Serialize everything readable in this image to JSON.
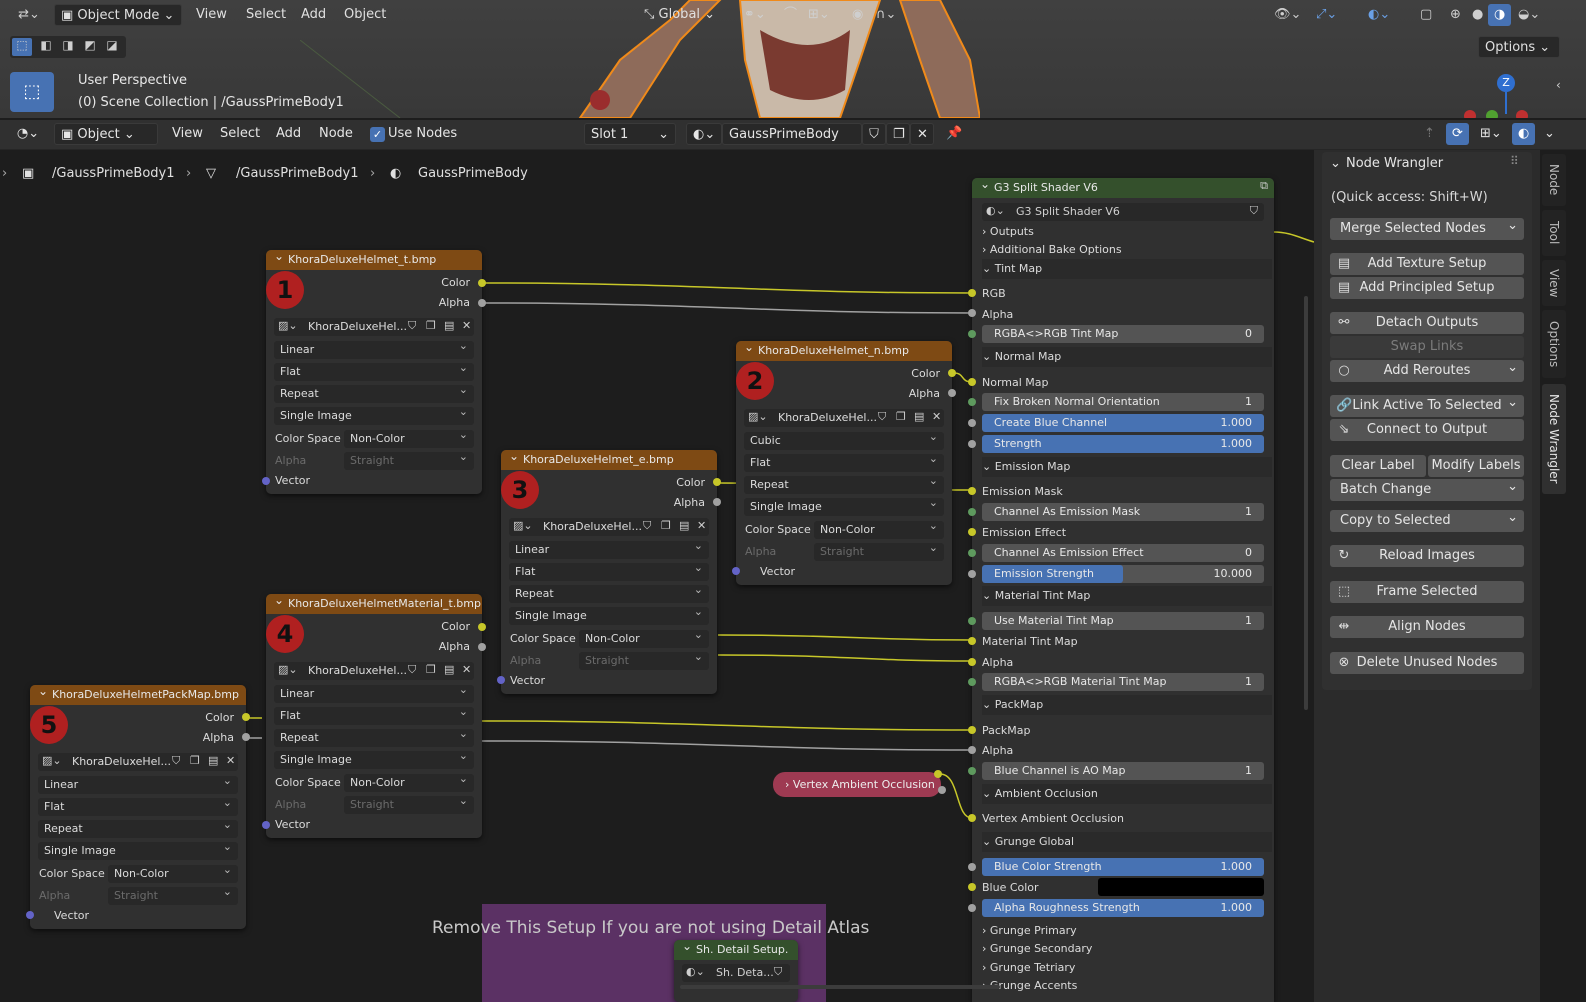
{
  "viewport": {
    "mode": "Object Mode",
    "menus": [
      "View",
      "Select",
      "Add",
      "Object"
    ],
    "transform_orientation": "Global",
    "options_label": "Options",
    "perspective_label": "User Perspective",
    "collection_label": "(0) Scene Collection | /GaussPrimeBody1",
    "gizmo_axis": "Z"
  },
  "node_header": {
    "mode": "Object",
    "menus": [
      "View",
      "Select",
      "Add",
      "Node"
    ],
    "use_nodes_label": "Use Nodes",
    "slot": "Slot 1",
    "material_name": "GaussPrimeBody"
  },
  "breadcrumb": [
    "/GaussPrimeBody1",
    "/GaussPrimeBody1",
    "GaussPrimeBody"
  ],
  "common": {
    "color": "Color",
    "alpha": "Alpha",
    "vector": "Vector",
    "color_space": "Color Space",
    "non_color": "Non-Color",
    "straight": "Straight",
    "flat": "Flat",
    "repeat": "Repeat",
    "single_image": "Single Image",
    "image_short": "KhoraDeluxeHel..."
  },
  "nodes": [
    {
      "title": "KhoraDeluxeHelmet_t.bmp",
      "number": "1",
      "interp": "Linear"
    },
    {
      "title": "KhoraDeluxeHelmet_n.bmp",
      "number": "2",
      "interp": "Cubic"
    },
    {
      "title": "KhoraDeluxeHelmet_e.bmp",
      "number": "3",
      "interp": "Linear"
    },
    {
      "title": "KhoraDeluxeHelmetMaterial_t.bmp",
      "number": "4",
      "interp": "Linear"
    },
    {
      "title": "KhoraDeluxeHelmetPackMap.bmp",
      "number": "5",
      "interp": "Linear"
    }
  ],
  "vao_node": "Vertex Ambient Occlusion",
  "frame_label": "Remove This Setup If you are not using Detail Atlas",
  "detail_node": {
    "title": "Sh. Detail Setup.",
    "field": "Sh. Deta..."
  },
  "group": {
    "title": "G3 Split Shader V6",
    "datablock": "G3 Split Shader V6",
    "outputs": "Outputs",
    "bake": "Additional Bake Options",
    "tint_map": "Tint Map",
    "rgb": "RGB",
    "alpha": "Alpha",
    "tint_bar": {
      "label": "RGBA<>RGB Tint Map",
      "value": "0"
    },
    "normal_map_sec": "Normal Map",
    "normal_map": "Normal Map",
    "fix_broken": {
      "label": "Fix Broken Normal Orientation",
      "value": "1"
    },
    "create_blue": {
      "label": "Create Blue Channel",
      "value": "1.000",
      "fill": 1.0
    },
    "strength": {
      "label": "Strength",
      "value": "1.000",
      "fill": 1.0
    },
    "emission_sec": "Emission Map",
    "emission_mask": "Emission Mask",
    "chan_mask": {
      "label": "Channel As Emission Mask",
      "value": "1"
    },
    "emission_effect": "Emission Effect",
    "chan_effect": {
      "label": "Channel As Emission Effect",
      "value": "0"
    },
    "emission_strength": {
      "label": "Emission Strength",
      "value": "10.000",
      "fill": 0.5
    },
    "mat_tint_sec": "Material Tint Map",
    "use_mat_tint": {
      "label": "Use Material Tint Map",
      "value": "1"
    },
    "mat_tint_map": "Material Tint Map",
    "rgba_mat": {
      "label": "RGBA<>RGB Material Tint Map",
      "value": "1"
    },
    "packmap_sec": "PackMap",
    "packmap": "PackMap",
    "blue_ao": {
      "label": "Blue Channel is AO Map",
      "value": "1"
    },
    "ao_sec": "Ambient Occlusion",
    "vao": "Vertex Ambient Occlusion",
    "grunge_global": "Grunge Global",
    "blue_color_strength": {
      "label": "Blue Color Strength",
      "value": "1.000",
      "fill": 1.0
    },
    "blue_color": "Blue Color",
    "alpha_rough": {
      "label": "Alpha Roughness Strength",
      "value": "1.000",
      "fill": 1.0
    },
    "grunge_primary": "Grunge Primary",
    "grunge_secondary": "Grunge Secondary",
    "grunge_tertiary": "Grunge Tetriary",
    "grunge_accents": "Grunge Accents"
  },
  "panel": {
    "title": "Node Wrangler",
    "quick": "(Quick access: Shift+W)",
    "merge": "Merge Selected Nodes",
    "add_texture": "Add Texture Setup",
    "add_principled": "Add Principled Setup",
    "detach": "Detach Outputs",
    "swap": "Swap Links",
    "reroutes": "Add Reroutes",
    "link_active": "Link Active To Selected",
    "connect_output": "Connect to Output",
    "clear_label": "Clear Label",
    "modify_labels": "Modify Labels",
    "batch": "Batch Change",
    "copy_sel": "Copy to Selected",
    "reload": "Reload Images",
    "frame_sel": "Frame Selected",
    "align": "Align Nodes",
    "delete_unused": "Delete Unused Nodes"
  },
  "tabs": [
    "Node",
    "Tool",
    "View",
    "Options",
    "Node Wrangler"
  ]
}
